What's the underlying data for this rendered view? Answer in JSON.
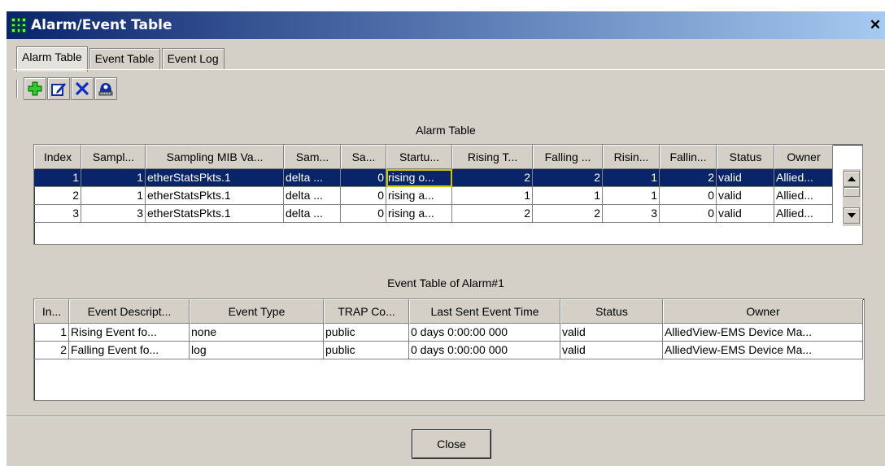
{
  "window": {
    "title": "Alarm/Event Table"
  },
  "tabs": [
    {
      "label": "Alarm Table",
      "active": true
    },
    {
      "label": "Event Table"
    },
    {
      "label": "Event Log"
    }
  ],
  "toolbar": {
    "icons": [
      "add-icon",
      "edit-icon",
      "delete-icon",
      "event-icon"
    ]
  },
  "alarm_table": {
    "title": "Alarm Table",
    "columns": [
      "Index",
      "Sampl...",
      "Sampling MIB Va...",
      "Sam...",
      "Sa...",
      "Startu...",
      "Rising T...",
      "Falling ...",
      "Risin...",
      "Fallin...",
      "Status",
      "Owner"
    ],
    "rows": [
      [
        "1",
        "1",
        "etherStatsPkts.1",
        "delta ...",
        "0",
        "rising o...",
        "2",
        "2",
        "1",
        "2",
        "valid",
        "Allied..."
      ],
      [
        "2",
        "1",
        "etherStatsPkts.1",
        "delta ...",
        "0",
        "rising a...",
        "1",
        "1",
        "1",
        "0",
        "valid",
        "Allied..."
      ],
      [
        "3",
        "3",
        "etherStatsPkts.1",
        "delta ...",
        "0",
        "rising a...",
        "2",
        "2",
        "3",
        "0",
        "valid",
        "Allied..."
      ]
    ]
  },
  "event_table": {
    "title": "Event Table of Alarm#1",
    "columns": [
      "In...",
      "Event Descript...",
      "Event Type",
      "TRAP Co...",
      "Last Sent Event Time",
      "Status",
      "Owner"
    ],
    "rows": [
      [
        "1",
        "Rising Event fo...",
        "none",
        "public",
        "0 days 0:00:00 000",
        "valid",
        "AlliedView-EMS Device Ma..."
      ],
      [
        "2",
        "Falling Event fo...",
        "log",
        "public",
        "0 days 0:00:00 000",
        "valid",
        "AlliedView-EMS Device Ma..."
      ]
    ]
  },
  "buttons": {
    "close": "Close"
  },
  "colors": {
    "selection": "#0a246a",
    "titlebar": "#0a246a",
    "face": "#d4d0c8"
  }
}
